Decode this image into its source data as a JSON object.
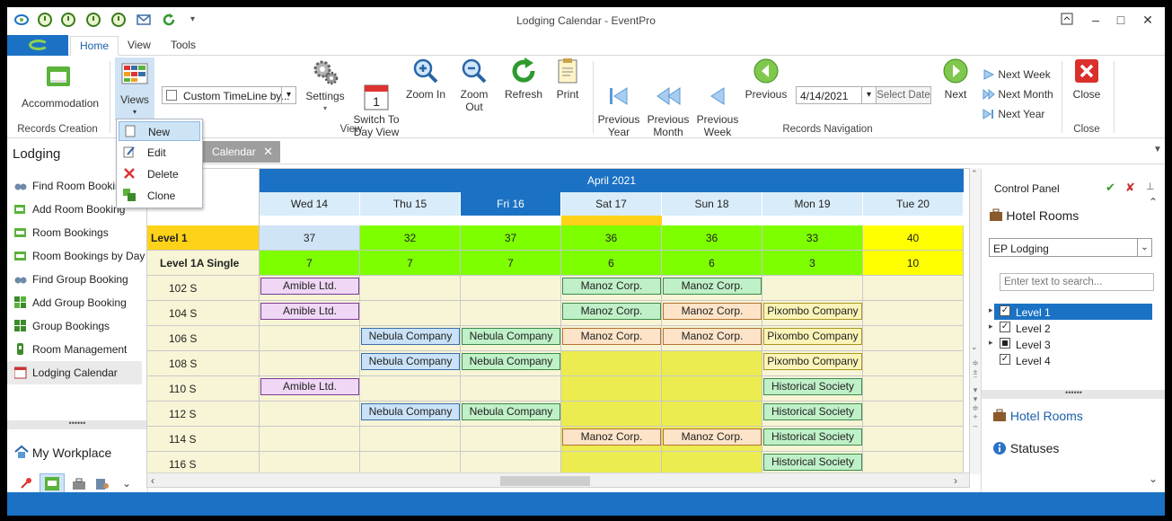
{
  "window": {
    "title": "Lodging Calendar - EventPro"
  },
  "ribbon_tabs": [
    "Home",
    "View",
    "Tools"
  ],
  "ribbon": {
    "accommodation": "Accommodation",
    "views": "Views",
    "timeline_value": "Custom TimeLine by...",
    "settings": "Settings",
    "switch_to_day_view": "Switch To\nDay View",
    "zoom_in": "Zoom In",
    "zoom_out": "Zoom Out",
    "refresh": "Refresh",
    "print": "Print",
    "previous_year": "Previous\nYear",
    "previous_month": "Previous\nMonth",
    "previous_week": "Previous\nWeek",
    "previous": "Previous",
    "date_value": "4/14/2021",
    "select_date": "Select Date",
    "next": "Next",
    "next_week": "Next Week",
    "next_month": "Next Month",
    "next_year": "Next Year",
    "close": "Close",
    "groups": {
      "records_creation": "Records Creation",
      "view": "View",
      "records_navigation": "Records Navigation",
      "close": "Close"
    }
  },
  "views_menu": [
    "New",
    "Edit",
    "Delete",
    "Clone"
  ],
  "left_panel": {
    "title": "Lodging",
    "items": [
      "Find Room Booking",
      "Add Room Booking",
      "Room Bookings",
      "Room Bookings by Day",
      "Find Group Booking",
      "Add Group Booking",
      "Group Bookings",
      "Room Management",
      "Lodging Calendar"
    ],
    "workplace": "My Workplace"
  },
  "doc_tab": "Calendar",
  "calendar": {
    "month": "April 2021",
    "days": [
      "Wed 14",
      "Thu 15",
      "Fri 16",
      "Sat 17",
      "Sun 18",
      "Mon 19",
      "Tue 20"
    ],
    "level_row": {
      "label": "Level 1",
      "values": [
        "37",
        "32",
        "37",
        "36",
        "36",
        "33",
        "40"
      ]
    },
    "type_row": {
      "label": "Level 1A Single",
      "values": [
        "7",
        "7",
        "7",
        "6",
        "6",
        "3",
        "10"
      ]
    },
    "rooms": [
      "102 S",
      "104 S",
      "106 S",
      "108 S",
      "110 S",
      "112 S",
      "114 S",
      "116 S"
    ],
    "bookings": [
      {
        "room": 0,
        "day": 0,
        "text": "Amible Ltd.",
        "color": "purple"
      },
      {
        "room": 0,
        "day": 3,
        "text": "Manoz Corp.",
        "color": "green"
      },
      {
        "room": 0,
        "day": 4,
        "text": "Manoz Corp.",
        "color": "green"
      },
      {
        "room": 1,
        "day": 0,
        "text": "Amible Ltd.",
        "color": "purple"
      },
      {
        "room": 1,
        "day": 3,
        "text": "Manoz Corp.",
        "color": "green"
      },
      {
        "room": 1,
        "day": 4,
        "text": "Manoz Corp.",
        "color": "peach"
      },
      {
        "room": 1,
        "day": 5,
        "text": "Pixombo Company",
        "color": "yellow"
      },
      {
        "room": 2,
        "day": 1,
        "text": "Nebula Company",
        "color": "blue"
      },
      {
        "room": 2,
        "day": 2,
        "text": "Nebula Company",
        "color": "green"
      },
      {
        "room": 2,
        "day": 3,
        "text": "Manoz Corp.",
        "color": "peach"
      },
      {
        "room": 2,
        "day": 4,
        "text": "Manoz Corp.",
        "color": "peach"
      },
      {
        "room": 2,
        "day": 5,
        "text": "Pixombo Company",
        "color": "yellow"
      },
      {
        "room": 3,
        "day": 1,
        "text": "Nebula Company",
        "color": "blue"
      },
      {
        "room": 3,
        "day": 2,
        "text": "Nebula Company",
        "color": "green"
      },
      {
        "room": 3,
        "day": 5,
        "text": "Pixombo Company",
        "color": "yellow"
      },
      {
        "room": 4,
        "day": 0,
        "text": "Amible Ltd.",
        "color": "purple"
      },
      {
        "room": 4,
        "day": 5,
        "text": "Historical Society",
        "color": "green"
      },
      {
        "room": 5,
        "day": 1,
        "text": "Nebula Company",
        "color": "blue"
      },
      {
        "room": 5,
        "day": 2,
        "text": "Nebula Company",
        "color": "green"
      },
      {
        "room": 5,
        "day": 5,
        "text": "Historical Society",
        "color": "green"
      },
      {
        "room": 6,
        "day": 3,
        "text": "Manoz Corp.",
        "color": "peach"
      },
      {
        "room": 6,
        "day": 4,
        "text": "Manoz Corp.",
        "color": "peach"
      },
      {
        "room": 6,
        "day": 5,
        "text": "Historical Society",
        "color": "green"
      },
      {
        "room": 7,
        "day": 5,
        "text": "Historical Society",
        "color": "green"
      }
    ]
  },
  "control_panel": {
    "title": "Control Panel",
    "hotel_rooms": "Hotel Rooms",
    "lodging_select": "EP Lodging",
    "search_placeholder": "Enter text to search...",
    "levels": [
      {
        "label": "Level 1",
        "checked": true
      },
      {
        "label": "Level 2",
        "checked": true
      },
      {
        "label": "Level 3",
        "checked": false
      },
      {
        "label": "Level 4",
        "checked": true
      }
    ],
    "hotel_rooms_link": "Hotel Rooms",
    "statuses": "Statuses"
  },
  "colors": {
    "accent": "#1b72c4",
    "level_yellow": "#ffd21a",
    "avail_green": "#7dff00",
    "avail_yellow": "#ffff00",
    "weekend_fill": "#ecec50",
    "room_bg": "#f8f5d6"
  }
}
